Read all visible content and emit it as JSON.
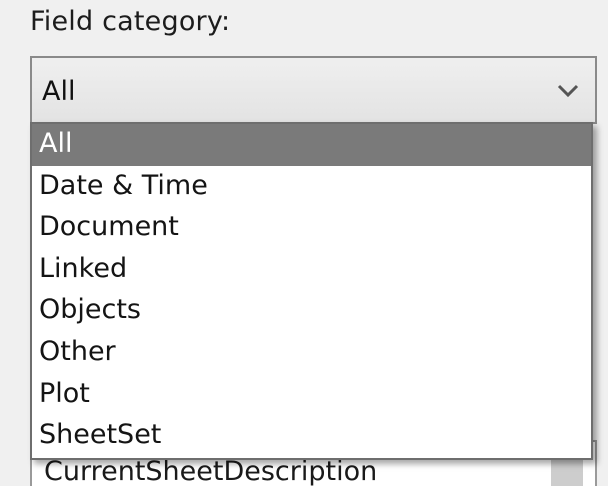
{
  "field_category": {
    "label": "Field category:",
    "selected_value": "All",
    "dropdown_icon": "chevron-down-icon",
    "options": [
      "All",
      "Date & Time",
      "Document",
      "Linked",
      "Objects",
      "Other",
      "Plot",
      "SheetSet"
    ],
    "highlighted_option": "All"
  },
  "field_names": {
    "visible_item": "CurrentSheetDescription"
  },
  "colors": {
    "highlight_bg": "#7a7a7a",
    "highlight_text": "#ffffff"
  }
}
